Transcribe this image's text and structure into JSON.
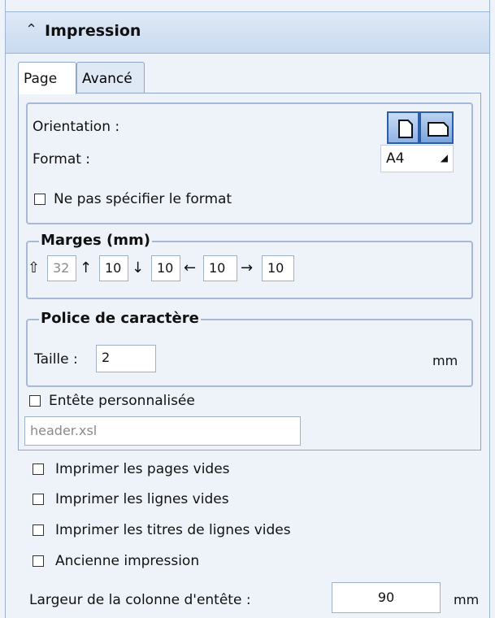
{
  "header": {
    "chevron": "⌃",
    "title": "Impression"
  },
  "tabs": {
    "page": "Page",
    "advanced": "Avancé"
  },
  "page_tab": {
    "orientation_label": "Orientation :",
    "format_label": "Format :",
    "format_value": "A4",
    "no_format_label": "Ne pas spécifier le format",
    "margins": {
      "legend": "Marges (mm)",
      "header": "32",
      "top": "10",
      "bottom": "10",
      "left": "10",
      "right": "10"
    },
    "font": {
      "legend": "Police de caractère",
      "size_label": "Taille :",
      "size_value": "2",
      "unit": "mm"
    },
    "custom_header_label": "Entête personnalisée",
    "custom_header_placeholder": "header.xsl"
  },
  "options": {
    "print_empty_pages": "Imprimer les pages vides",
    "print_empty_lines": "Imprimer les lignes vides",
    "print_empty_line_titles": "Imprimer les titres de lignes vides",
    "legacy_print": "Ancienne impression"
  },
  "header_column": {
    "label": "Largeur de la colonne d'entête :",
    "value": "90",
    "unit": "mm"
  },
  "icons": [
    "chevron-up-icon",
    "portrait-page-icon",
    "landscape-page-icon",
    "dropdown-arrow-icon",
    "arrow-up-icon",
    "arrow-down-icon",
    "arrow-left-icon",
    "arrow-right-icon"
  ]
}
